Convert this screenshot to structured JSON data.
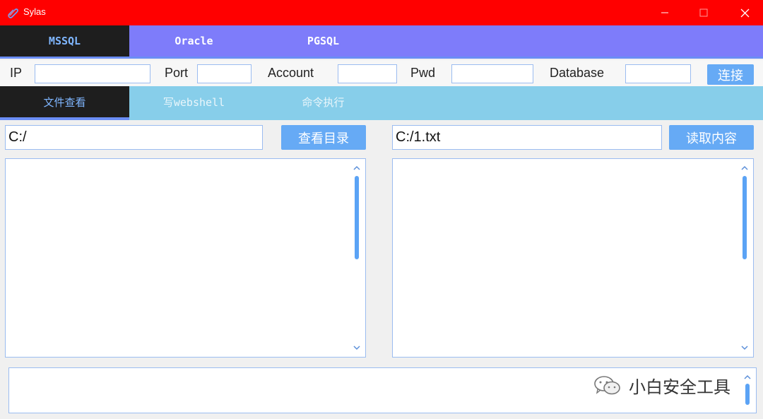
{
  "window": {
    "title": "Sylas",
    "minimize_glyph": "—",
    "maximize_glyph": "☐",
    "close_glyph": "✕"
  },
  "db_tabs": [
    {
      "label": "MSSQL",
      "active": true
    },
    {
      "label": "Oracle",
      "active": false
    },
    {
      "label": "PGSQL",
      "active": false
    }
  ],
  "connection": {
    "ip_label": "IP",
    "ip_value": "",
    "port_label": "Port",
    "port_value": "",
    "account_label": "Account",
    "account_value": "",
    "pwd_label": "Pwd",
    "pwd_value": "",
    "database_label": "Database",
    "database_value": "",
    "connect_label": "连接"
  },
  "func_tabs": [
    {
      "label": "文件查看",
      "active": true
    },
    {
      "label": "写webshell",
      "active": false
    },
    {
      "label": "命令执行",
      "active": false
    }
  ],
  "file_browser": {
    "dir_path": "C:/",
    "list_dir_label": "查看目录",
    "file_path": "C:/1.txt",
    "read_file_label": "读取内容",
    "dir_output": "",
    "file_output": ""
  },
  "log_output": "",
  "watermark": {
    "text": "小白安全工具"
  },
  "colors": {
    "titlebar": "#ff0000",
    "db_tabbar": "#7e7cfa",
    "func_tabbar": "#87ceea",
    "active_tab_bg": "#1e1e1e",
    "active_tab_text": "#7fb6ff",
    "button_blue": "#66aaf5",
    "border_blue": "#9bbcf0"
  },
  "icons": {
    "app": "paperclip-icon",
    "scroll_up": "chevron-up-icon",
    "scroll_down": "chevron-down-icon",
    "watermark": "wechat-icon"
  }
}
